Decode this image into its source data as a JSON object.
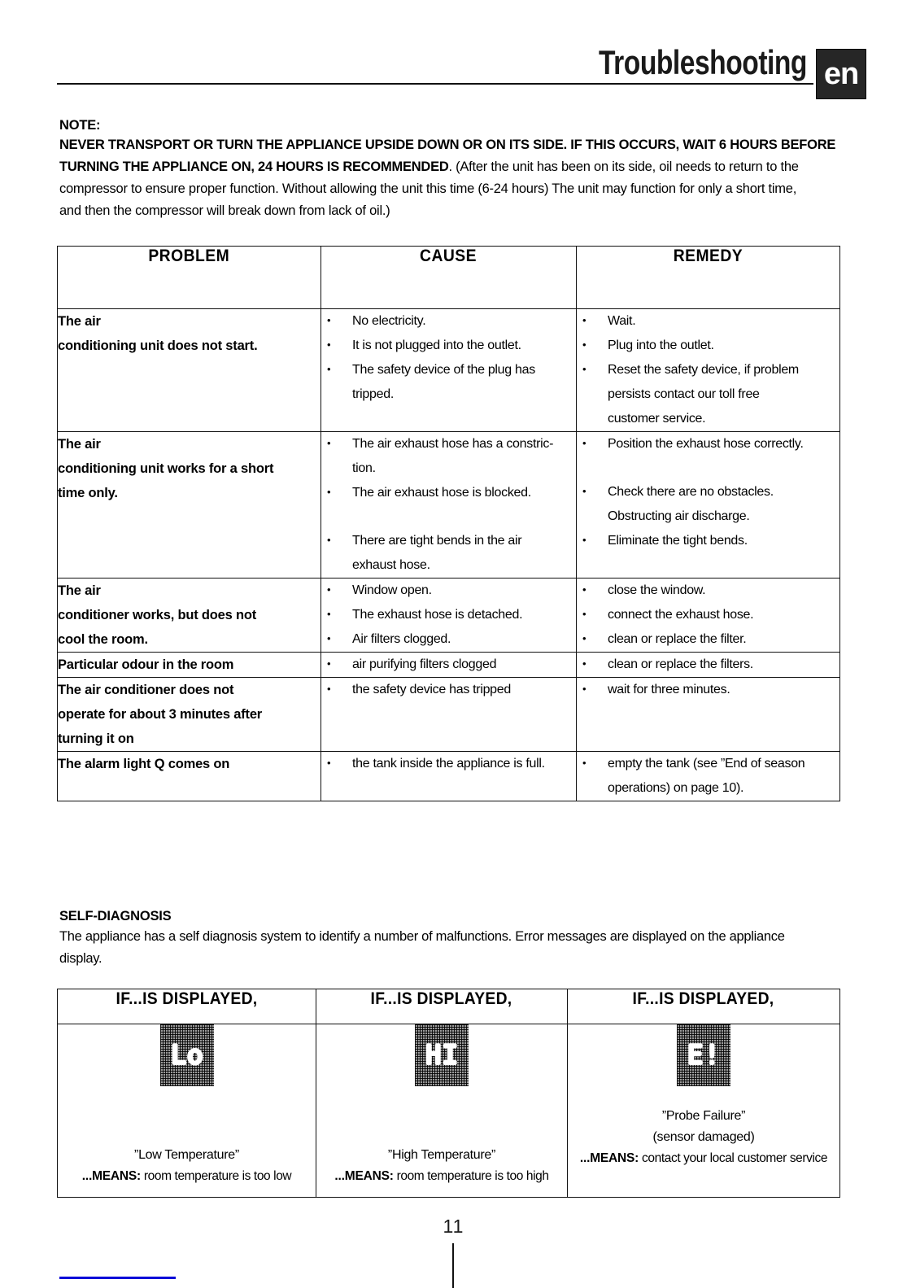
{
  "header": {
    "title": "Troubleshooting",
    "language_badge": "en"
  },
  "note": {
    "label": "NOTE:",
    "line1": "NEVER TRANSPORT OR TURN THE APPLIANCE UPSIDE DOWN OR ON ITS SIDE. IF THIS OCCURS, WAIT 6 HOURS BEFORE",
    "line2_bold": "TURNING THE APPLIANCE ON, 24 HOURS IS RECOMMENDED",
    "line2_rest": ". (After the unit has been on its side, oil needs to return to the",
    "line3": "compressor to ensure proper function.  Without allowing the unit this time (6-24 hours) The unit may function for only a short time,",
    "line4": "and then the compressor will break down from lack of oil.)"
  },
  "table": {
    "headers": {
      "problem": "PROBLEM",
      "cause": "CAUSE",
      "remedy": "REMEDY"
    },
    "rows": [
      {
        "problem_lines": [
          "The air",
          "conditioning unit does not start."
        ],
        "causes": [
          {
            "lines": [
              "No electricity."
            ],
            "gap": false
          },
          {
            "lines": [
              "It is not plugged into the outlet."
            ],
            "gap": false
          },
          {
            "lines": [
              "The safety device of the plug has",
              "tripped."
            ],
            "gap": false
          }
        ],
        "remedies": [
          {
            "lines": [
              "Wait."
            ],
            "gap": false
          },
          {
            "lines": [
              "Plug into the outlet."
            ],
            "gap": false
          },
          {
            "lines": [
              "Reset the safety device, if problem",
              "persists contact our toll free",
              "customer service."
            ],
            "gap": false
          }
        ]
      },
      {
        "problem_lines": [
          "The air",
          "conditioning unit works for a short",
          "time only."
        ],
        "causes": [
          {
            "lines": [
              "The air exhaust hose has a constric-",
              "tion."
            ],
            "gap": false
          },
          {
            "lines": [
              "The air exhaust hose is blocked."
            ],
            "gap": false
          },
          {
            "lines": [
              "There are  tight bends in the air",
              "exhaust hose."
            ],
            "gap": true
          }
        ],
        "remedies": [
          {
            "lines": [
              "Position the exhaust hose correctly."
            ],
            "gap": false
          },
          {
            "lines": [
              "Check there are no obstacles.",
              "Obstructing air discharge."
            ],
            "gap": true
          },
          {
            "lines": [
              "Eliminate the tight bends."
            ],
            "gap": false
          }
        ]
      },
      {
        "problem_lines": [
          "The air",
          "conditioner works, but does not",
          "cool the room."
        ],
        "causes": [
          {
            "lines": [
              "Window open."
            ],
            "gap": false
          },
          {
            "lines": [
              "The exhaust hose is detached."
            ],
            "gap": false
          },
          {
            "lines": [
              "Air filters clogged."
            ],
            "gap": false
          }
        ],
        "remedies": [
          {
            "lines": [
              "close the window."
            ],
            "gap": false
          },
          {
            "lines": [
              "connect the exhaust hose."
            ],
            "gap": false
          },
          {
            "lines": [
              "clean or replace the filter."
            ],
            "gap": false
          }
        ]
      },
      {
        "problem_lines": [
          "Particular odour in the room"
        ],
        "causes": [
          {
            "lines": [
              "air purifying filters clogged"
            ],
            "gap": false
          }
        ],
        "remedies": [
          {
            "lines": [
              "clean or replace the filters."
            ],
            "gap": false
          }
        ]
      },
      {
        "problem_lines": [
          "The air conditioner does not",
          "operate for about 3 minutes after",
          "turning it on"
        ],
        "causes": [
          {
            "lines": [
              "the safety device has tripped"
            ],
            "gap": false
          }
        ],
        "remedies": [
          {
            "lines": [
              "wait for three minutes."
            ],
            "gap": false
          }
        ]
      },
      {
        "problem_lines": [
          "The alarm light Q comes on"
        ],
        "causes": [
          {
            "lines": [
              "the tank inside the appliance is full."
            ],
            "gap": false
          }
        ],
        "remedies": [
          {
            "lines": [
              "empty the tank (see ”End of season",
              "operations) on page  10)."
            ],
            "gap": false
          }
        ]
      }
    ]
  },
  "self_diagnosis": {
    "title": "SELF-DIAGNOSIS",
    "body_lines": [
      "The appliance has a self diagnosis system to identify a number of malfunctions. Error messages are displayed on the appliance",
      "display."
    ],
    "columns": [
      {
        "header": "IF...IS DISPLAYED,",
        "display_code": "Lo",
        "display_icon": "led-display-low-temperature",
        "caption": "”Low Temperature”",
        "subcaption": "",
        "means_label": "...MEANS:",
        "means_text": " room temperature is too low"
      },
      {
        "header": "IF...IS DISPLAYED,",
        "display_code": "HI",
        "display_icon": "led-display-high-temperature",
        "caption": "”High Temperature”",
        "subcaption": "",
        "means_label": "...MEANS:",
        "means_text": " room temperature is too high"
      },
      {
        "header": "IF...IS DISPLAYED,",
        "display_code": "E!",
        "display_icon": "led-display-probe-failure",
        "caption": "”Probe Failure”",
        "subcaption": "(sensor damaged)",
        "means_label": "...MEANS:",
        "means_text": " contact your local customer service"
      }
    ]
  },
  "footer": {
    "page_number": "11"
  },
  "colors": {
    "ink": "#111111",
    "badge_background": "#262626",
    "blue_rule": "#0000d8",
    "led_background": "#9a9a9a"
  }
}
